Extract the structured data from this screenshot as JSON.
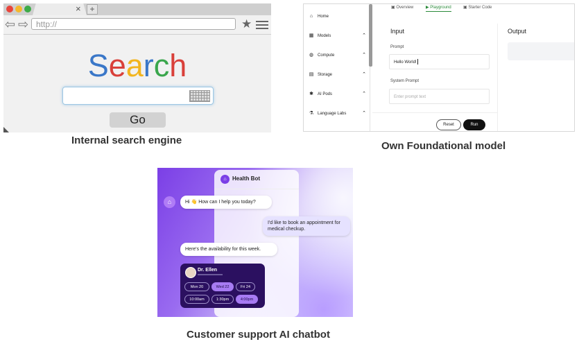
{
  "captions": {
    "search": "Internal search engine",
    "model": "Own Foundational model",
    "chatbot": "Customer support AI chatbot"
  },
  "browser": {
    "window_dots": [
      "#e8453c",
      "#f5b82e",
      "#3dab48"
    ],
    "tab_close": "×",
    "new_tab": "+",
    "back": "⇦",
    "forward": "⇨",
    "url": "http://",
    "star": "★",
    "logo_letters": [
      {
        "ch": "S",
        "color": "#3a77c8"
      },
      {
        "ch": "e",
        "color": "#d9403a"
      },
      {
        "ch": "a",
        "color": "#f2b51e"
      },
      {
        "ch": "r",
        "color": "#3a77c8"
      },
      {
        "ch": "c",
        "color": "#3aa64c"
      },
      {
        "ch": "h",
        "color": "#d9403a"
      }
    ],
    "go_label": "Go"
  },
  "playground": {
    "sidebar": [
      {
        "icon": "⌂",
        "label": "Home",
        "chev": ""
      },
      {
        "icon": "▦",
        "label": "Models",
        "chev": "⌃"
      },
      {
        "icon": "◍",
        "label": "Compute",
        "chev": "⌃"
      },
      {
        "icon": "▤",
        "label": "Storage",
        "chev": "⌃"
      },
      {
        "icon": "✱",
        "label": "AI Pods",
        "chev": "⌃"
      },
      {
        "icon": "⚗",
        "label": "Language Labs",
        "chev": "⌃"
      }
    ],
    "tabs": [
      {
        "icon": "▣",
        "label": "Overview"
      },
      {
        "icon": "▶",
        "label": "Playground"
      },
      {
        "icon": "▣",
        "label": "Starter Code"
      }
    ],
    "input_heading": "Input",
    "output_heading": "Output",
    "prompt_label": "Prompt",
    "prompt_value": "Hello World!",
    "system_prompt_label": "System Prompt",
    "system_prompt_placeholder": "Enter prompt text",
    "reset_label": "Reset",
    "run_label": "Run"
  },
  "chatbot": {
    "title": "Health Bot",
    "messages": [
      {
        "from": "bot",
        "text": "Hi 👋 How can I help you today?"
      },
      {
        "from": "user",
        "text": "I'd like to book an appointment for medical checkup."
      },
      {
        "from": "bot",
        "text": "Here's the availability for this week."
      }
    ],
    "doctor": "Dr. Ellen",
    "days": [
      {
        "label": "Mon 20",
        "selected": false
      },
      {
        "label": "Wed 22",
        "selected": true
      },
      {
        "label": "Fri 24",
        "selected": false
      }
    ],
    "times": [
      {
        "label": "10:00am",
        "selected": false
      },
      {
        "label": "1:30pm",
        "selected": false
      },
      {
        "label": "4:00pm",
        "selected": true
      }
    ]
  }
}
